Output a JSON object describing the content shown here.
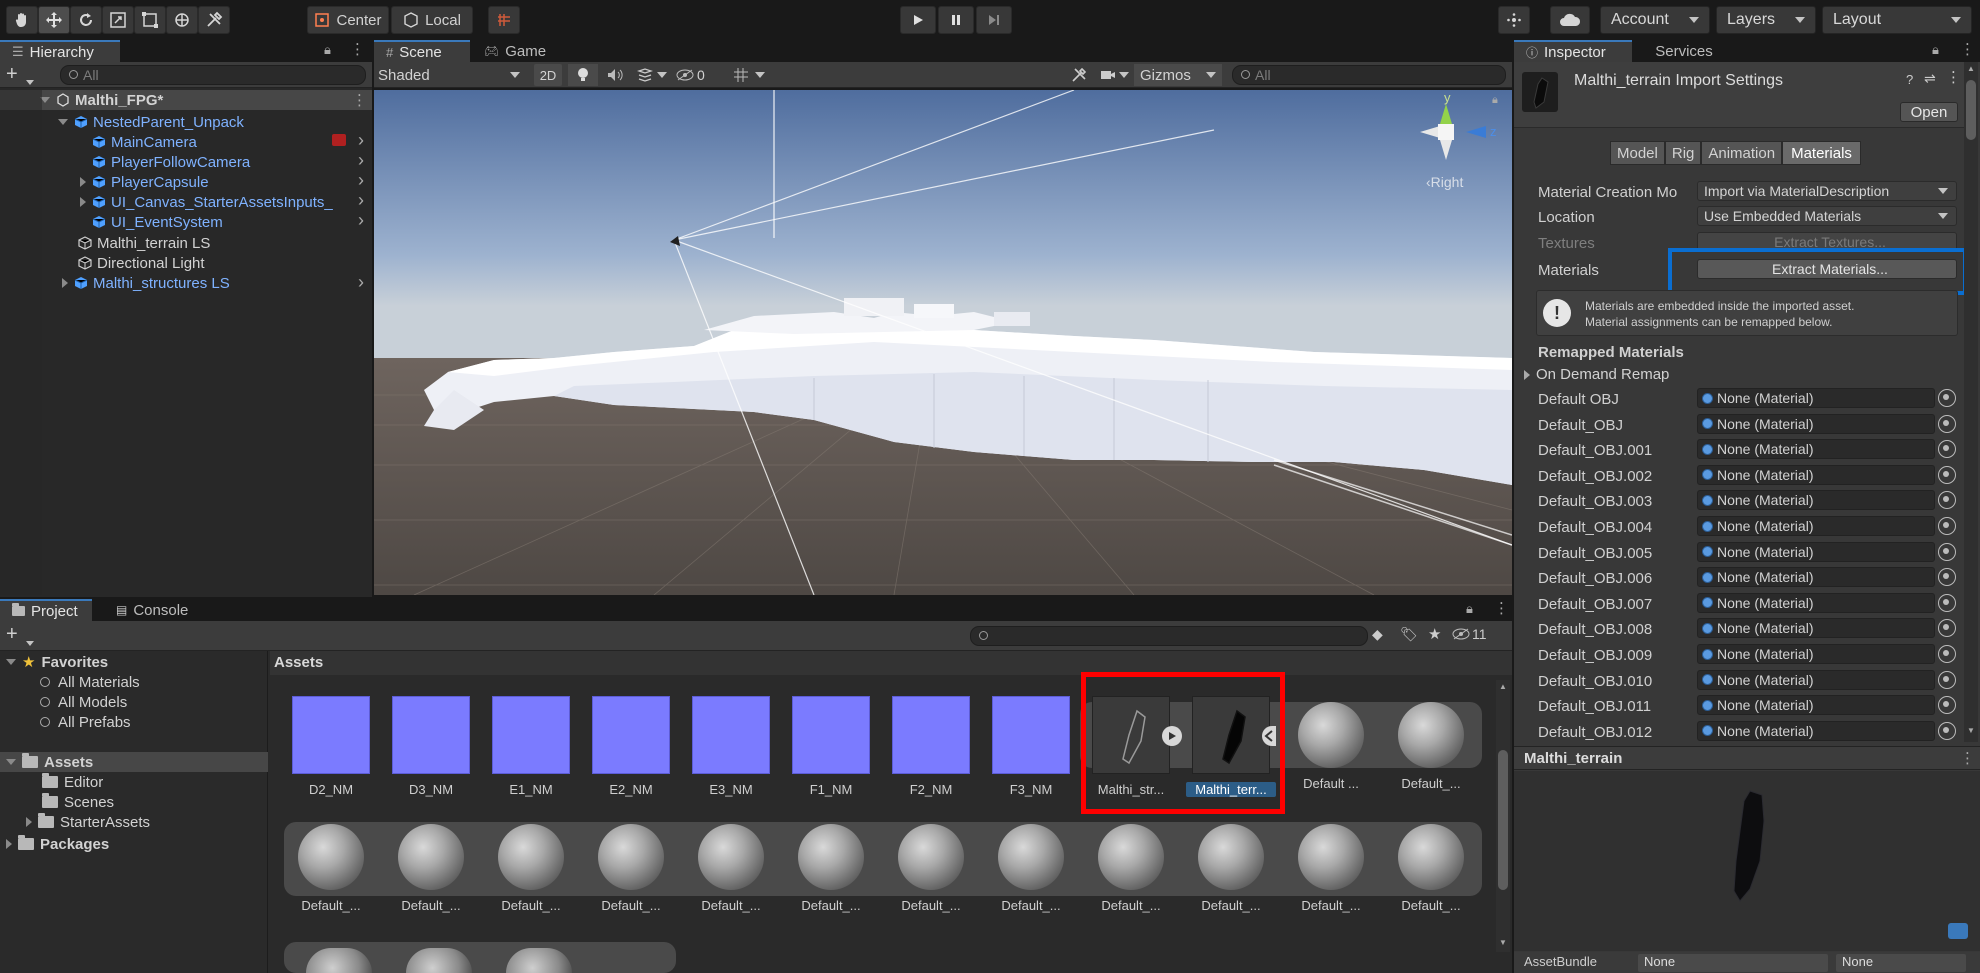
{
  "toolbar": {
    "pivot_label": "Center",
    "space_label": "Local",
    "account_label": "Account",
    "layers_label": "Layers",
    "layout_label": "Layout"
  },
  "hierarchy": {
    "tab_label": "Hierarchy",
    "search_placeholder": "All",
    "scene_name": "Malthi_FPG*",
    "items": [
      {
        "label": "NestedParent_Unpack"
      },
      {
        "label": "MainCamera"
      },
      {
        "label": "PlayerFollowCamera"
      },
      {
        "label": "PlayerCapsule"
      },
      {
        "label": "UI_Canvas_StarterAssetsInputs_"
      },
      {
        "label": "UI_EventSystem"
      },
      {
        "label": "Malthi_terrain LS"
      },
      {
        "label": "Directional Light"
      },
      {
        "label": "Malthi_structures LS"
      }
    ]
  },
  "scene": {
    "tabs": [
      {
        "label": "Scene"
      },
      {
        "label": "Game"
      }
    ],
    "shading_mode": "Shaded",
    "mode_2d": "2D",
    "hidden_count": "0",
    "gizmos_label": "Gizmos",
    "search_placeholder": "All",
    "gizmo_axes": {
      "y": "y",
      "z": "z",
      "view": "Right"
    }
  },
  "inspector": {
    "tabs": [
      {
        "label": "Inspector"
      },
      {
        "label": "Services"
      }
    ],
    "title": "Malthi_terrain Import Settings",
    "open_button": "Open",
    "import_tabs": [
      {
        "label": "Model"
      },
      {
        "label": "Rig"
      },
      {
        "label": "Animation"
      },
      {
        "label": "Materials"
      }
    ],
    "material_creation_label": "Material Creation Mo",
    "material_creation_value": "Import via MaterialDescription",
    "location_label": "Location",
    "location_value": "Use Embedded Materials",
    "textures_label": "Textures",
    "extract_textures_button": "Extract Textures...",
    "materials_label": "Materials",
    "extract_materials_button": "Extract Materials...",
    "info_line1": "Materials are embedded inside the imported asset.",
    "info_line2": "Material assignments can be remapped below.",
    "remapped_header": "Remapped Materials",
    "on_demand_label": "On Demand Remap",
    "remap_rows": [
      {
        "name": "Default OBJ",
        "value": "None (Material)"
      },
      {
        "name": "Default_OBJ",
        "value": "None (Material)"
      },
      {
        "name": "Default_OBJ.001",
        "value": "None (Material)"
      },
      {
        "name": "Default_OBJ.002",
        "value": "None (Material)"
      },
      {
        "name": "Default_OBJ.003",
        "value": "None (Material)"
      },
      {
        "name": "Default_OBJ.004",
        "value": "None (Material)"
      },
      {
        "name": "Default_OBJ.005",
        "value": "None (Material)"
      },
      {
        "name": "Default_OBJ.006",
        "value": "None (Material)"
      },
      {
        "name": "Default_OBJ.007",
        "value": "None (Material)"
      },
      {
        "name": "Default_OBJ.008",
        "value": "None (Material)"
      },
      {
        "name": "Default_OBJ.009",
        "value": "None (Material)"
      },
      {
        "name": "Default_OBJ.010",
        "value": "None (Material)"
      },
      {
        "name": "Default_OBJ.011",
        "value": "None (Material)"
      },
      {
        "name": "Default_OBJ.012",
        "value": "None (Material)"
      }
    ],
    "preview_title": "Malthi_terrain",
    "asset_bundle_label": "AssetBundle",
    "asset_bundle_value": "None",
    "asset_bundle_variant": "None"
  },
  "project": {
    "tabs": [
      {
        "label": "Project"
      },
      {
        "label": "Console"
      }
    ],
    "hidden_count": "11",
    "favorites_label": "Favorites",
    "favorites": [
      {
        "label": "All Materials"
      },
      {
        "label": "All Models"
      },
      {
        "label": "All Prefabs"
      }
    ],
    "assets_label": "Assets",
    "folders": [
      {
        "label": "Editor"
      },
      {
        "label": "Scenes"
      },
      {
        "label": "StarterAssets"
      }
    ],
    "packages_label": "Packages",
    "breadcrumb": "Assets",
    "row1": [
      {
        "name": "D2_NM"
      },
      {
        "name": "D3_NM"
      },
      {
        "name": "E1_NM"
      },
      {
        "name": "E2_NM"
      },
      {
        "name": "E3_NM"
      },
      {
        "name": "F1_NM"
      },
      {
        "name": "F2_NM"
      },
      {
        "name": "F3_NM"
      },
      {
        "name": "Malthi_str..."
      },
      {
        "name": "Malthi_terr..."
      },
      {
        "name": "Default ..."
      },
      {
        "name": "Default_..."
      }
    ],
    "row2": [
      {
        "name": "Default_..."
      },
      {
        "name": "Default_..."
      },
      {
        "name": "Default_..."
      },
      {
        "name": "Default_..."
      },
      {
        "name": "Default_..."
      },
      {
        "name": "Default_..."
      },
      {
        "name": "Default_..."
      },
      {
        "name": "Default_..."
      },
      {
        "name": "Default_..."
      },
      {
        "name": "Default_..."
      },
      {
        "name": "Default_..."
      },
      {
        "name": "Default_..."
      }
    ]
  },
  "annotations": {
    "red_box_color": "#ff0000",
    "blue_box_color": "#0a6ed1"
  }
}
